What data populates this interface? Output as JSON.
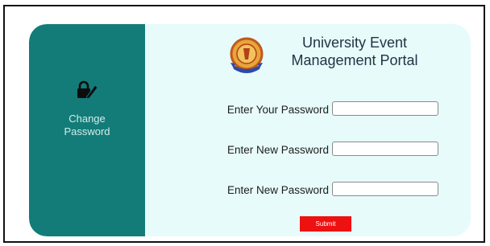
{
  "sidebar": {
    "icon": "lock-edit-icon",
    "label_line1": "Change",
    "label_line2": "Password"
  },
  "header": {
    "logo": "university-seal-logo",
    "title_line1": "University Event",
    "title_line2": "Management Portal"
  },
  "form": {
    "current_password_label": "Enter Your Password",
    "current_password_value": "",
    "new_password_label": "Enter New Password",
    "new_password_value": "",
    "confirm_password_label": "Enter New Password",
    "confirm_password_value": "",
    "submit_label": "Submit"
  },
  "colors": {
    "sidebar": "#137c78",
    "panel": "#e7fbfa",
    "submit": "#ee1111"
  }
}
